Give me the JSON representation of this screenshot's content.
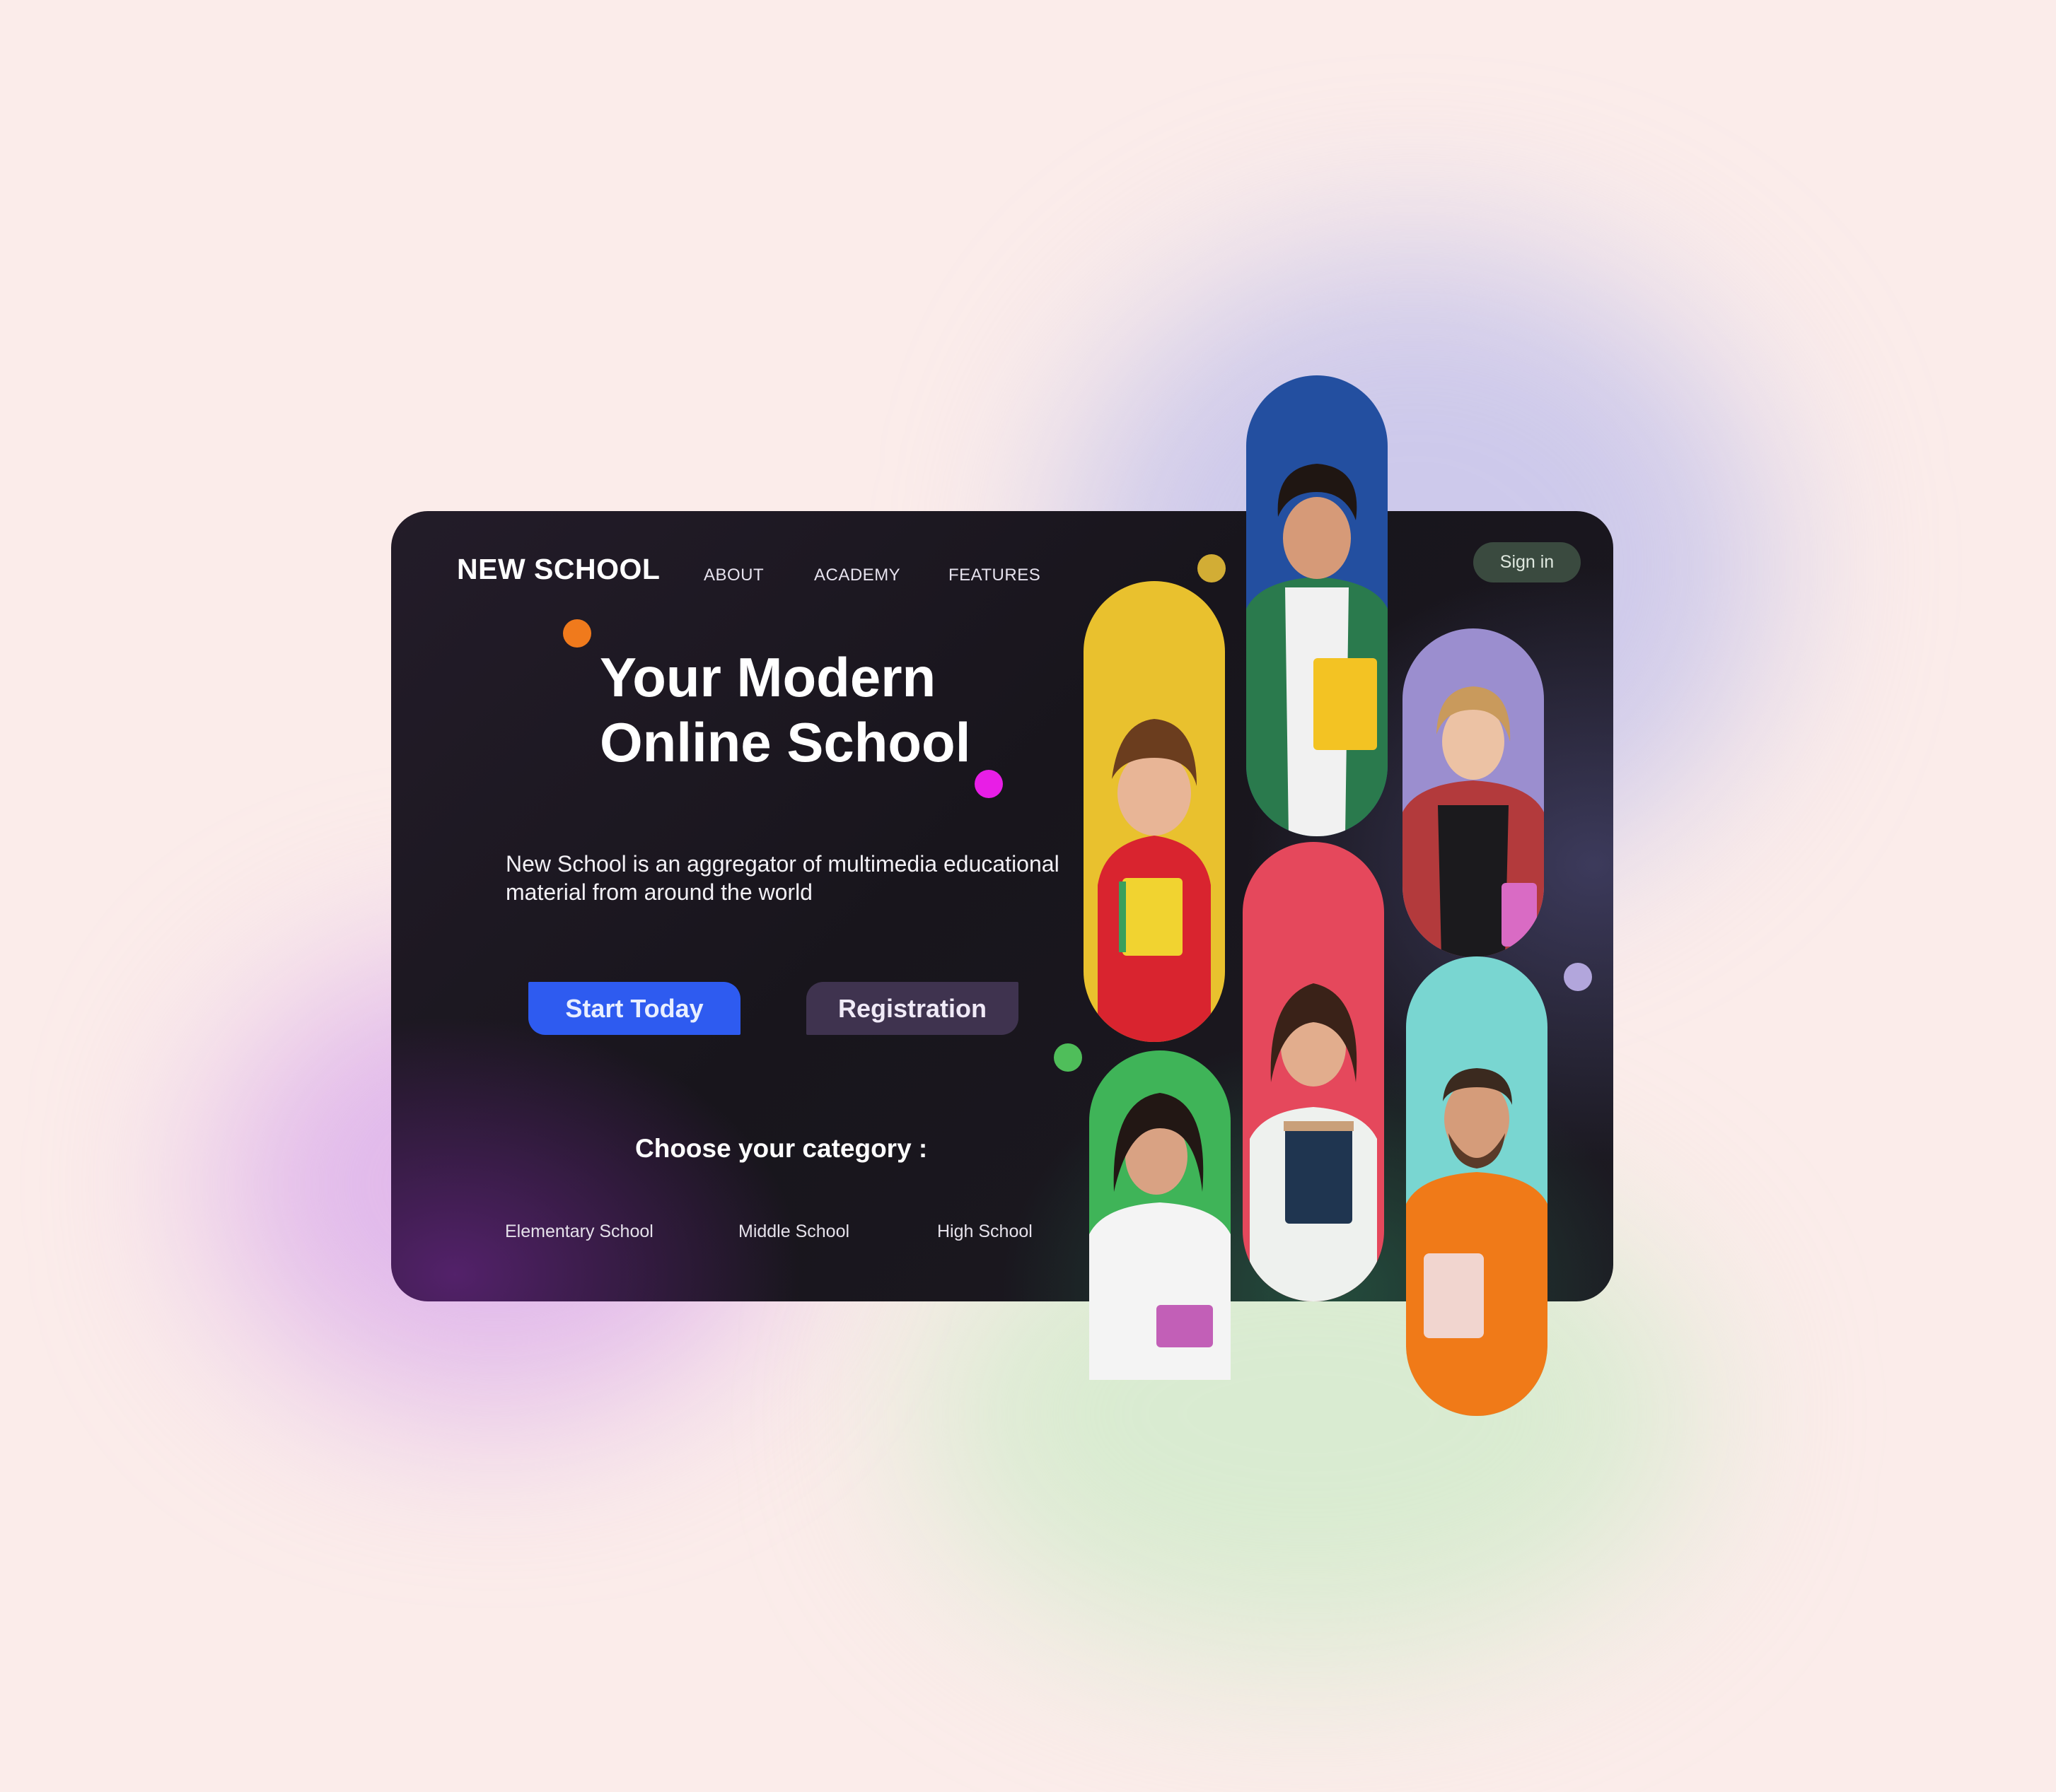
{
  "brand": "NEW SCHOOL",
  "nav": [
    "ABOUT",
    "ACADEMY",
    "FEATURES"
  ],
  "signin": "Sign in",
  "hero": {
    "line1": "Your Modern",
    "line2": "Online School"
  },
  "description": "New School is an aggregator of multimedia educational material from around the world",
  "buttons": {
    "start": "Start Today",
    "register": "Registration"
  },
  "category": {
    "title": "Choose your category :",
    "items": [
      "Elementary School",
      "Middle School",
      "High School"
    ]
  },
  "colors": {
    "start_button": "#2e5bf0",
    "register_button": "#3f334f",
    "signin_button": "#3a4a3f",
    "pill_yellow": "#e9c12e",
    "pill_blue": "#234fa0",
    "pill_lavender": "#9b8ecf",
    "pill_red": "#e5485c",
    "pill_green": "#3fb458",
    "pill_teal": "#79d6d1"
  },
  "photos": [
    "student-red-hoodie-photo",
    "student-plaid-shirt-photo",
    "student-blonde-photo",
    "student-brunette-books-photo",
    "student-white-shirt-photo",
    "student-orange-sweater-photo"
  ]
}
